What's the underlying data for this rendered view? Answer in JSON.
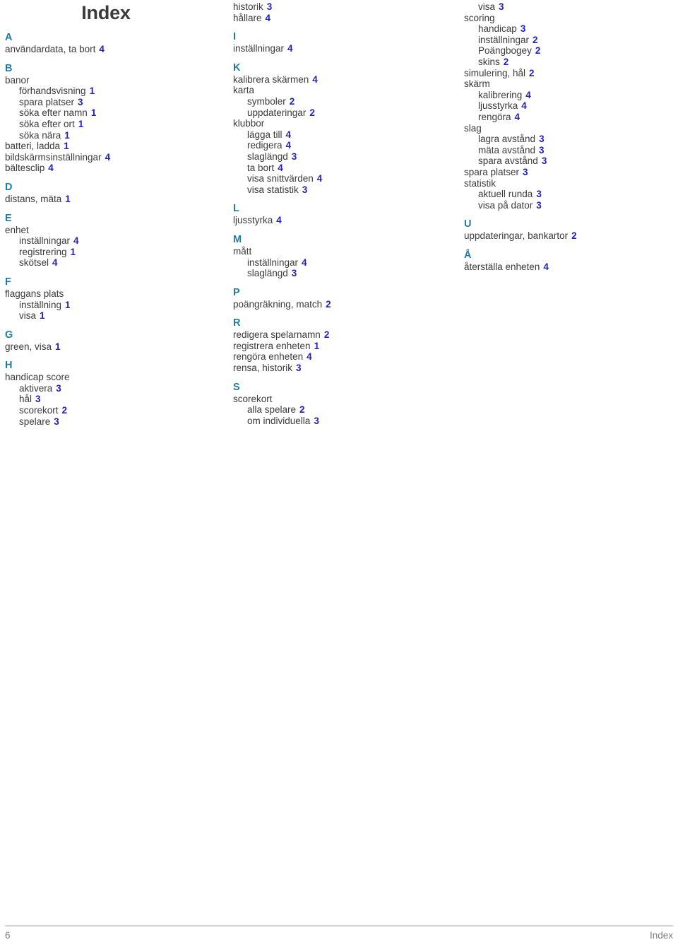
{
  "title": "Index",
  "footer": {
    "page_number": "6",
    "section_label": "Index"
  },
  "colors": {
    "letter_heading": "#1f7ca6",
    "page_number": "#2222bb",
    "body_text": "#3a3a3a",
    "title": "#3b3b3b",
    "footer_text": "#7d7d7d",
    "rule": "#d6d6d6"
  },
  "columns": [
    {
      "id": "column-1",
      "blocks": [
        {
          "type": "letter",
          "label": "A"
        },
        {
          "type": "entry",
          "level": 1,
          "text": "användardata, ta bort",
          "page": "4"
        },
        {
          "type": "letter",
          "label": "B"
        },
        {
          "type": "entry",
          "level": 1,
          "text": "banor",
          "page": ""
        },
        {
          "type": "entry",
          "level": 2,
          "text": "förhandsvisning",
          "page": "1"
        },
        {
          "type": "entry",
          "level": 2,
          "text": "spara platser",
          "page": "3"
        },
        {
          "type": "entry",
          "level": 2,
          "text": "söka efter namn",
          "page": "1"
        },
        {
          "type": "entry",
          "level": 2,
          "text": "söka efter ort",
          "page": "1"
        },
        {
          "type": "entry",
          "level": 2,
          "text": "söka nära",
          "page": "1"
        },
        {
          "type": "entry",
          "level": 1,
          "text": "batteri, ladda",
          "page": "1"
        },
        {
          "type": "entry",
          "level": 1,
          "text": "bildskärmsinställningar",
          "page": "4"
        },
        {
          "type": "entry",
          "level": 1,
          "text": "bältesclip",
          "page": "4"
        },
        {
          "type": "letter",
          "label": "D"
        },
        {
          "type": "entry",
          "level": 1,
          "text": "distans, mäta",
          "page": "1"
        },
        {
          "type": "letter",
          "label": "E"
        },
        {
          "type": "entry",
          "level": 1,
          "text": "enhet",
          "page": ""
        },
        {
          "type": "entry",
          "level": 2,
          "text": "inställningar",
          "page": "4"
        },
        {
          "type": "entry",
          "level": 2,
          "text": "registrering",
          "page": "1"
        },
        {
          "type": "entry",
          "level": 2,
          "text": "skötsel",
          "page": "4"
        },
        {
          "type": "letter",
          "label": "F"
        },
        {
          "type": "entry",
          "level": 1,
          "text": "flaggans plats",
          "page": ""
        },
        {
          "type": "entry",
          "level": 2,
          "text": "inställning",
          "page": "1"
        },
        {
          "type": "entry",
          "level": 2,
          "text": "visa",
          "page": "1"
        },
        {
          "type": "letter",
          "label": "G"
        },
        {
          "type": "entry",
          "level": 1,
          "text": "green, visa",
          "page": "1"
        },
        {
          "type": "letter",
          "label": "H"
        },
        {
          "type": "entry",
          "level": 1,
          "text": "handicap score",
          "page": ""
        },
        {
          "type": "entry",
          "level": 2,
          "text": "aktivera",
          "page": "3"
        },
        {
          "type": "entry",
          "level": 2,
          "text": "hål",
          "page": "3"
        },
        {
          "type": "entry",
          "level": 2,
          "text": "scorekort",
          "page": "2"
        },
        {
          "type": "entry",
          "level": 2,
          "text": "spelare",
          "page": "3"
        }
      ]
    },
    {
      "id": "column-2",
      "blocks": [
        {
          "type": "entry",
          "level": 1,
          "text": "historik",
          "page": "3"
        },
        {
          "type": "entry",
          "level": 1,
          "text": "hållare",
          "page": "4"
        },
        {
          "type": "letter",
          "label": "I"
        },
        {
          "type": "entry",
          "level": 1,
          "text": "inställningar",
          "page": "4"
        },
        {
          "type": "letter",
          "label": "K"
        },
        {
          "type": "entry",
          "level": 1,
          "text": "kalibrera skärmen",
          "page": "4"
        },
        {
          "type": "entry",
          "level": 1,
          "text": "karta",
          "page": ""
        },
        {
          "type": "entry",
          "level": 2,
          "text": "symboler",
          "page": "2"
        },
        {
          "type": "entry",
          "level": 2,
          "text": "uppdateringar",
          "page": "2"
        },
        {
          "type": "entry",
          "level": 1,
          "text": "klubbor",
          "page": ""
        },
        {
          "type": "entry",
          "level": 2,
          "text": "lägga till",
          "page": "4"
        },
        {
          "type": "entry",
          "level": 2,
          "text": "redigera",
          "page": "4"
        },
        {
          "type": "entry",
          "level": 2,
          "text": "slaglängd",
          "page": "3"
        },
        {
          "type": "entry",
          "level": 2,
          "text": "ta bort",
          "page": "4"
        },
        {
          "type": "entry",
          "level": 2,
          "text": "visa snittvärden",
          "page": "4"
        },
        {
          "type": "entry",
          "level": 2,
          "text": "visa statistik",
          "page": "3"
        },
        {
          "type": "letter",
          "label": "L"
        },
        {
          "type": "entry",
          "level": 1,
          "text": "ljusstyrka",
          "page": "4"
        },
        {
          "type": "letter",
          "label": "M"
        },
        {
          "type": "entry",
          "level": 1,
          "text": "mått",
          "page": ""
        },
        {
          "type": "entry",
          "level": 2,
          "text": "inställningar",
          "page": "4"
        },
        {
          "type": "entry",
          "level": 2,
          "text": "slaglängd",
          "page": "3"
        },
        {
          "type": "letter",
          "label": "P"
        },
        {
          "type": "entry",
          "level": 1,
          "text": "poängräkning, match",
          "page": "2"
        },
        {
          "type": "letter",
          "label": "R"
        },
        {
          "type": "entry",
          "level": 1,
          "text": "redigera spelarnamn",
          "page": "2"
        },
        {
          "type": "entry",
          "level": 1,
          "text": "registrera enheten",
          "page": "1"
        },
        {
          "type": "entry",
          "level": 1,
          "text": "rengöra enheten",
          "page": "4"
        },
        {
          "type": "entry",
          "level": 1,
          "text": "rensa, historik",
          "page": "3"
        },
        {
          "type": "letter",
          "label": "S"
        },
        {
          "type": "entry",
          "level": 1,
          "text": "scorekort",
          "page": ""
        },
        {
          "type": "entry",
          "level": 2,
          "text": "alla spelare",
          "page": "2"
        },
        {
          "type": "entry",
          "level": 2,
          "text": "om individuella",
          "page": "3"
        }
      ]
    },
    {
      "id": "column-3",
      "blocks": [
        {
          "type": "entry",
          "level": 2,
          "text": "visa",
          "page": "3"
        },
        {
          "type": "entry",
          "level": 1,
          "text": "scoring",
          "page": ""
        },
        {
          "type": "entry",
          "level": 2,
          "text": "handicap",
          "page": "3"
        },
        {
          "type": "entry",
          "level": 2,
          "text": "inställningar",
          "page": "2"
        },
        {
          "type": "entry",
          "level": 2,
          "text": "Poängbogey",
          "page": "2"
        },
        {
          "type": "entry",
          "level": 2,
          "text": "skins",
          "page": "2"
        },
        {
          "type": "entry",
          "level": 1,
          "text": "simulering, hål",
          "page": "2"
        },
        {
          "type": "entry",
          "level": 1,
          "text": "skärm",
          "page": ""
        },
        {
          "type": "entry",
          "level": 2,
          "text": "kalibrering",
          "page": "4"
        },
        {
          "type": "entry",
          "level": 2,
          "text": "ljusstyrka",
          "page": "4"
        },
        {
          "type": "entry",
          "level": 2,
          "text": "rengöra",
          "page": "4"
        },
        {
          "type": "entry",
          "level": 1,
          "text": "slag",
          "page": ""
        },
        {
          "type": "entry",
          "level": 2,
          "text": "lagra avstånd",
          "page": "3"
        },
        {
          "type": "entry",
          "level": 2,
          "text": "mäta avstånd",
          "page": "3"
        },
        {
          "type": "entry",
          "level": 2,
          "text": "spara avstånd",
          "page": "3"
        },
        {
          "type": "entry",
          "level": 1,
          "text": "spara platser",
          "page": "3"
        },
        {
          "type": "entry",
          "level": 1,
          "text": "statistik",
          "page": ""
        },
        {
          "type": "entry",
          "level": 2,
          "text": "aktuell runda",
          "page": "3"
        },
        {
          "type": "entry",
          "level": 2,
          "text": "visa på dator",
          "page": "3"
        },
        {
          "type": "letter",
          "label": "U"
        },
        {
          "type": "entry",
          "level": 1,
          "text": "uppdateringar, bankartor",
          "page": "2"
        },
        {
          "type": "letter",
          "label": "Å"
        },
        {
          "type": "entry",
          "level": 1,
          "text": "återställa enheten",
          "page": "4"
        }
      ]
    }
  ]
}
